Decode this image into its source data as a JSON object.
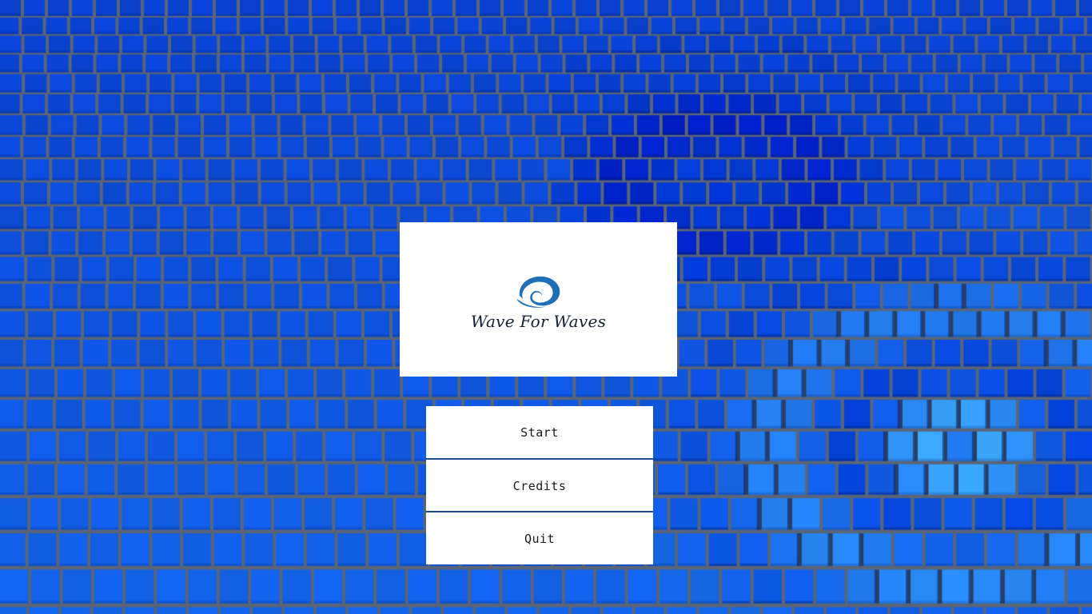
{
  "title_card": {
    "game_title": "Wave For Waves",
    "logo_icon": "wave-swirl-icon"
  },
  "menu": {
    "start_label": "Start",
    "credits_label": "Credits",
    "quit_label": "Quit"
  },
  "colors": {
    "background_blue": "#0a3fd0",
    "tile_blue": "#1456e8",
    "grid_gap": "#5a6577",
    "logo_blue": "#1e6fb8",
    "divider": "#1f4a8f"
  }
}
